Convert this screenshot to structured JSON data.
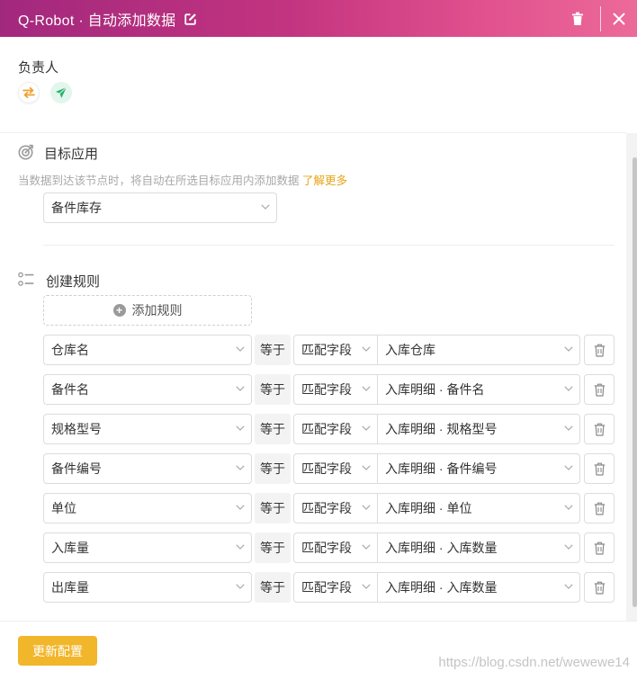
{
  "header": {
    "title": "Q-Robot · 自动添加数据"
  },
  "owner": {
    "label": "负责人"
  },
  "target_app": {
    "title": "目标应用",
    "description": "当数据到达该节点时，将自动在所选目标应用内添加数据",
    "learn_more": "了解更多",
    "selected": "备件库存"
  },
  "rules": {
    "title": "创建规则",
    "add_label": "添加规则",
    "items": [
      {
        "field": "仓库名",
        "op": "等于",
        "mode": "匹配字段",
        "value": "入库仓库"
      },
      {
        "field": "备件名",
        "op": "等于",
        "mode": "匹配字段",
        "value": "入库明细 · 备件名"
      },
      {
        "field": "规格型号",
        "op": "等于",
        "mode": "匹配字段",
        "value": "入库明细 · 规格型号"
      },
      {
        "field": "备件编号",
        "op": "等于",
        "mode": "匹配字段",
        "value": "入库明细 · 备件编号"
      },
      {
        "field": "单位",
        "op": "等于",
        "mode": "匹配字段",
        "value": "入库明细 · 单位"
      },
      {
        "field": "入库量",
        "op": "等于",
        "mode": "匹配字段",
        "value": "入库明细 · 入库数量"
      },
      {
        "field": "出库量",
        "op": "等于",
        "mode": "匹配字段",
        "value": "入库明细 · 入库数量"
      }
    ]
  },
  "footer": {
    "update_label": "更新配置"
  },
  "watermark": "https://blog.csdn.net/wewewe14",
  "colors": {
    "brand_start": "#a2287e",
    "brand_end": "#ec6a99",
    "accent": "#f2b62b",
    "link": "#e8a416"
  }
}
